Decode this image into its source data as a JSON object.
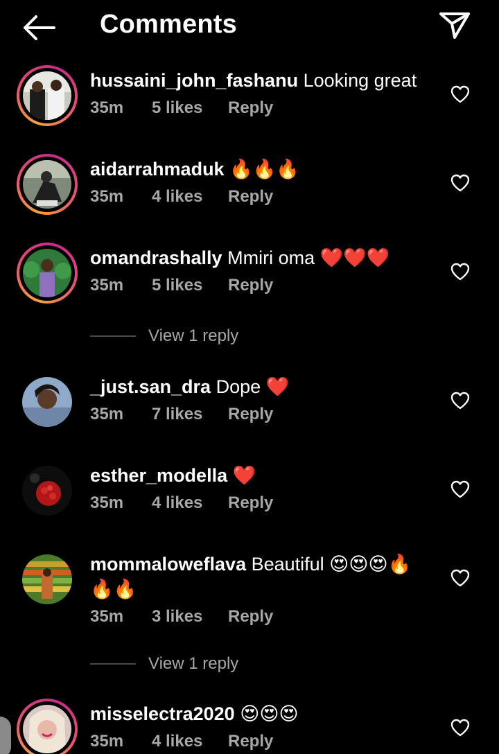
{
  "header": {
    "title": "Comments",
    "back_icon": "arrow-left-icon",
    "share_icon": "paper-plane-icon"
  },
  "comments": [
    {
      "username": "hussaini_john_fashanu",
      "text": "Looking great",
      "time": "35m",
      "likes": "5 likes",
      "reply": "Reply"
    },
    {
      "username": "aidarrahmaduk",
      "text": "🔥🔥🔥",
      "time": "35m",
      "likes": "4 likes",
      "reply": "Reply"
    },
    {
      "username": "omandrashally",
      "text": "Mmiri oma ❤️❤️❤️",
      "time": "35m",
      "likes": "5 likes",
      "reply": "Reply"
    },
    {
      "username": "_just.san_dra",
      "text": "Dope ❤️",
      "time": "35m",
      "likes": "7 likes",
      "reply": "Reply"
    },
    {
      "username": "esther_modella",
      "text": "❤️",
      "time": "35m",
      "likes": "4 likes",
      "reply": "Reply"
    },
    {
      "username": "mommaloweflava",
      "text": "Beautiful 😍😍😍🔥🔥🔥",
      "time": "35m",
      "likes": "3 likes",
      "reply": "Reply"
    },
    {
      "username": "misselectra2020",
      "text": "😍😍😍",
      "time": "35m",
      "likes": "4 likes",
      "reply": "Reply"
    }
  ],
  "view_replies": [
    {
      "label": "View 1 reply"
    },
    {
      "label": "View 1 reply"
    }
  ],
  "colors": {
    "background": "#000000",
    "text": "#ffffff",
    "secondary_text": "#a8a8a8",
    "story_ring_start": "#f9a13a",
    "story_ring_end": "#c8298b"
  }
}
